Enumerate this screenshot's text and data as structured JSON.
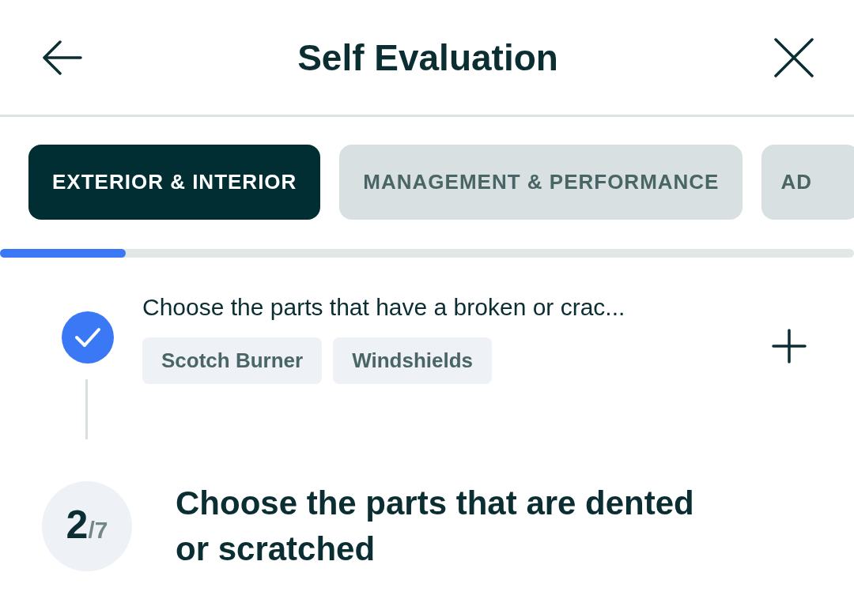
{
  "header": {
    "title": "Self Evaluation"
  },
  "tabs": [
    {
      "label": "EXTERIOR & INTERIOR",
      "selected": true
    },
    {
      "label": "MANAGEMENT & PERFORMANCE",
      "selected": false
    },
    {
      "label": "AD",
      "selected": false
    }
  ],
  "progress": {
    "level": 0.147
  },
  "questions": [
    {
      "kind": "answered",
      "text": "Choose the parts that have a broken or crac...",
      "answers": [
        "Scotch Burner",
        "Windshields"
      ]
    },
    {
      "kind": "current",
      "number": "2",
      "total": "/7",
      "text": "Choose the parts that are dented or scratched"
    }
  ]
}
